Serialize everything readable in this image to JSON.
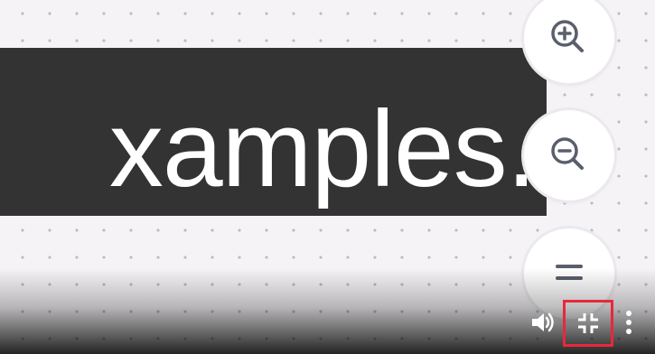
{
  "canvas": {
    "caption_text": "xamples."
  },
  "zoom_controls": {
    "zoom_in_icon": "zoom-in-icon",
    "zoom_out_icon": "zoom-out-icon",
    "reset_icon": "equals-icon"
  },
  "player_controls": {
    "volume_icon": "volume-icon",
    "exit_fullscreen_icon": "exit-fullscreen-icon",
    "more_icon": "more-vertical-icon",
    "highlight_color": "#e8283a"
  }
}
